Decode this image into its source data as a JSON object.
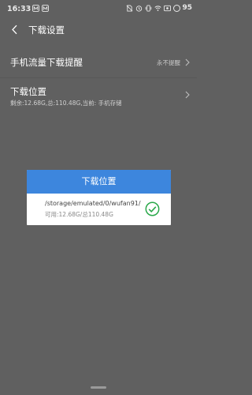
{
  "status_bar": {
    "time": "16:33",
    "battery_level": "95",
    "icons_left": [
      "app-m-icon",
      "app-m-icon"
    ],
    "icons_right": [
      "no-sim-icon",
      "alarm-icon",
      "vibrate-icon",
      "wifi-icon",
      "screen-record-icon",
      "battery-icon"
    ]
  },
  "header": {
    "title": "下载设置",
    "back_icon": "chevron-left-icon"
  },
  "settings": {
    "mobile_data_reminder": {
      "label": "手机流量下载提醒",
      "value": "永不提醒"
    },
    "download_location": {
      "label": "下载位置",
      "detail": "剩余:12.68G,总:110.48G,当前: 手机存储"
    }
  },
  "dialog": {
    "title": "下载位置",
    "option": {
      "path": "/storage/emulated/0/wufan91/",
      "space": "可用:12.68G/总110.48G",
      "selected_icon": "check-circle-icon"
    }
  },
  "colors": {
    "dialog_header": "#3d86dd",
    "check_green": "#2aa84a",
    "overlay_bg": "#606060"
  }
}
